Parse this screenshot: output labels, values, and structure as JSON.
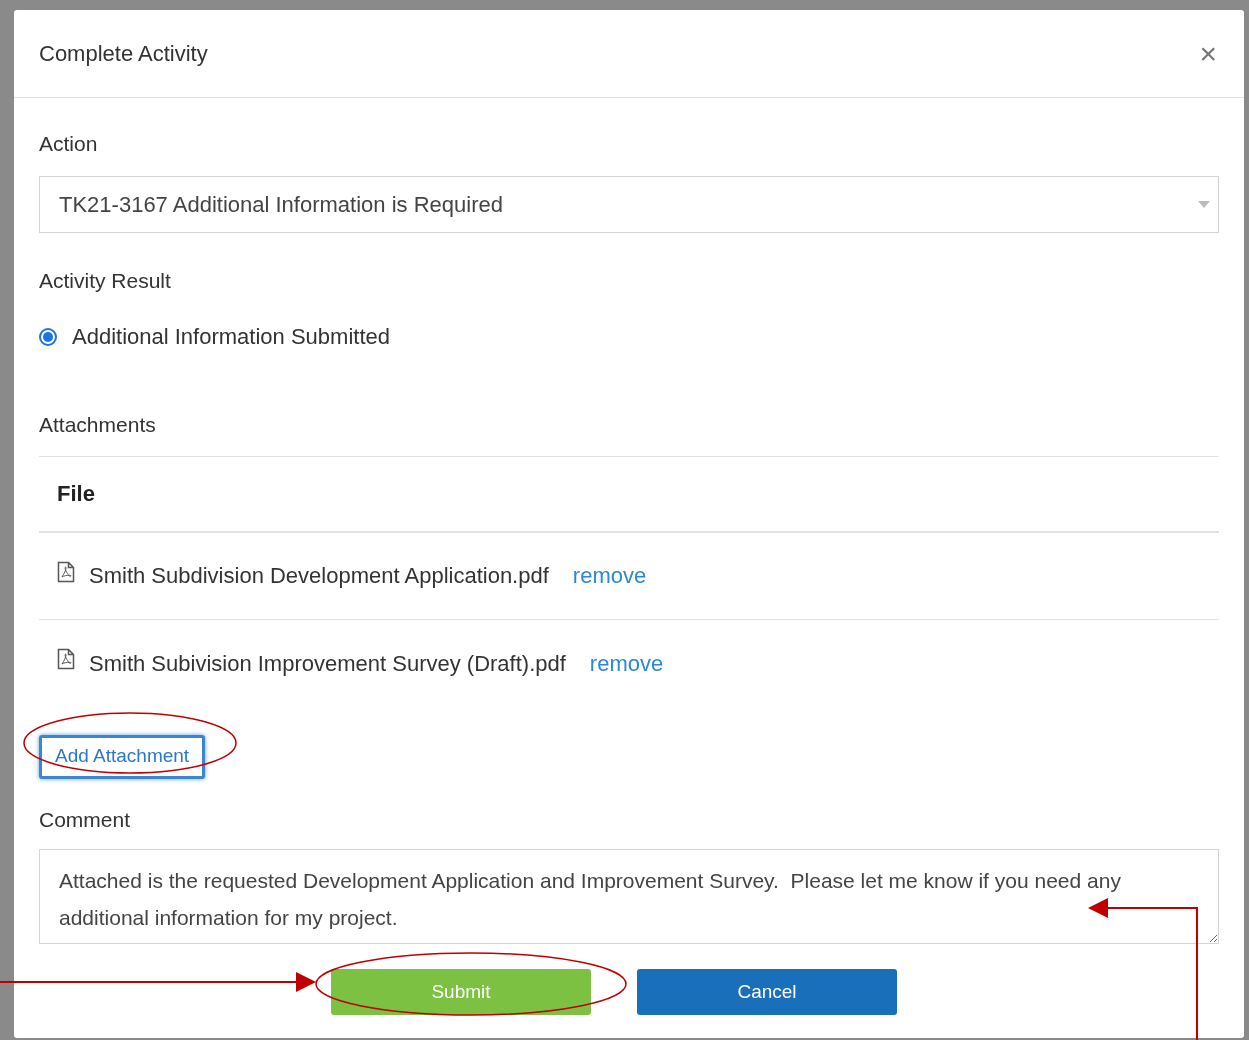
{
  "dialog": {
    "title": "Complete Activity",
    "close": "×"
  },
  "action": {
    "label": "Action",
    "value": "TK21-3167 Additional Information is Required"
  },
  "activity_result": {
    "label": "Activity Result",
    "options": [
      {
        "label": "Additional Information Submitted",
        "selected": true
      }
    ]
  },
  "attachments": {
    "label": "Attachments",
    "column": "File",
    "rows": [
      {
        "file": "Smith Subdivision Development Application.pdf",
        "link": "remove"
      },
      {
        "file": "Smith Subivision Improvement Survey (Draft).pdf",
        "link": "remove"
      }
    ],
    "add_button": "Add Attachment"
  },
  "comment": {
    "label": "Comment",
    "value": "Attached is the requested Development Application and Improvement Survey.  Please let me know if you need any additional information for my project."
  },
  "buttons": [
    {
      "label": "Submit",
      "kind": "primary"
    },
    {
      "label": "Cancel",
      "kind": "secondary"
    }
  ]
}
